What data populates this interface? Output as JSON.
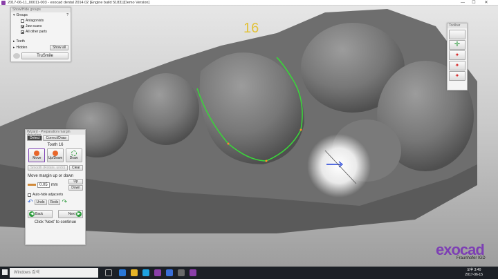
{
  "window": {
    "title": "2017-06-11_00011-003 - exocad dental 2014.02 [Engine build 5183] [Demo Version]",
    "minimize": "—",
    "maximize": "☐",
    "close": "✕"
  },
  "viewport": {
    "tooth_number": "16"
  },
  "show_hide_panel": {
    "header": "Show/Hide groups",
    "help": "?",
    "groups_label": "Groups",
    "items": [
      {
        "label": "Antagonists",
        "checked": false
      },
      {
        "label": "Jaw scans",
        "checked": true
      },
      {
        "label": "All other parts",
        "checked": true
      }
    ],
    "teeth_label": "Teeth",
    "hidden_label": "Hidden",
    "show_all": "Show all",
    "trusmile": "TruSmile"
  },
  "wizard": {
    "header": "Wizard - Preparation margin detection",
    "tab_detect": "Detect",
    "tab_correct": "Correct/Draw",
    "tooth_label": "Tooth 16",
    "tools": [
      {
        "label": "Move",
        "icon": "move-icon"
      },
      {
        "label": "Up/Down",
        "icon": "updown-icon"
      },
      {
        "label": "Draw",
        "icon": "draw-icon"
      }
    ],
    "smooth": "Smooth (Rotate, undo)",
    "clear": "Clear",
    "move_margin_label": "Move margin up or down",
    "value": "0.05",
    "unit": "mm",
    "up": "Up",
    "down": "Down",
    "auto_hide": "Auto-hide adjacents",
    "undo": "Undo",
    "redo": "Redo",
    "back": "Back",
    "next": "Next",
    "hint": "Click 'Next' to continue"
  },
  "toolbar": {
    "header": "Toolbar"
  },
  "branding": {
    "name": "exocad",
    "sub": "Fraunhofer",
    "sub2": "IGD"
  },
  "taskbar": {
    "search": "Windows 검색",
    "time": "오후 3:40",
    "date": "2017-06-15"
  },
  "colors": {
    "accent": "#7d3fb4",
    "margin_line": "#3bd43b",
    "tooth_number": "#e2c23a"
  }
}
